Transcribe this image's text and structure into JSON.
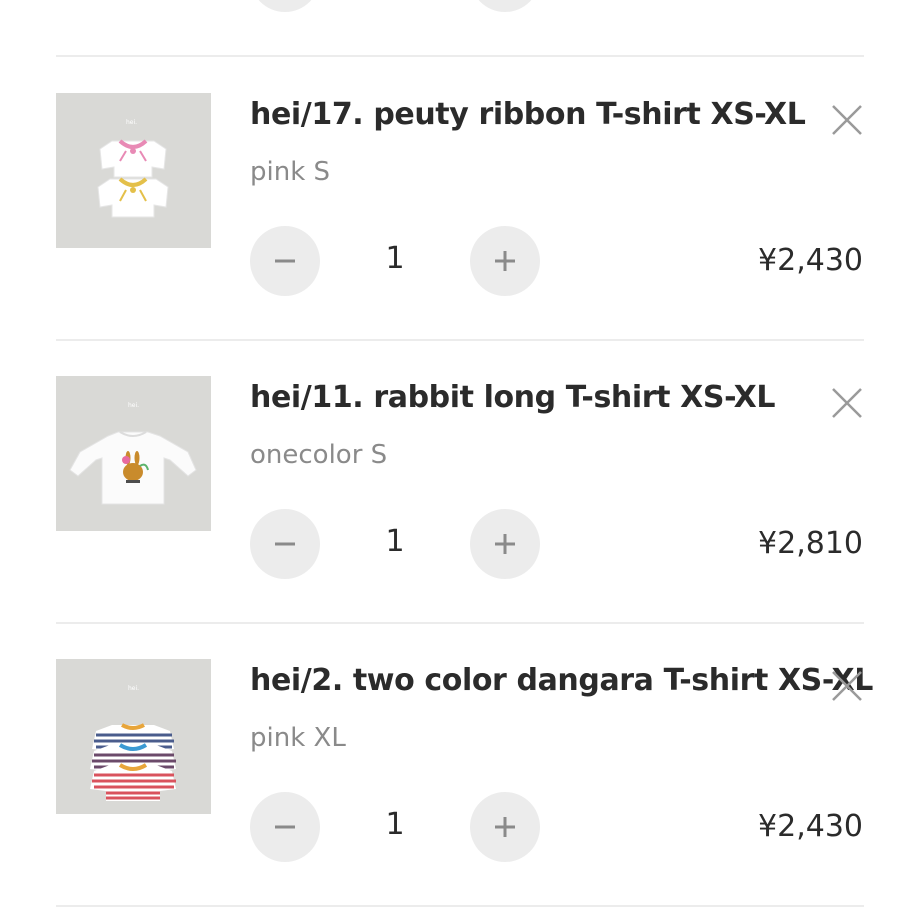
{
  "cart": {
    "items": [
      {
        "title": "hei/17. peuty ribbon T-shirt XS-XL",
        "variant": "pink S",
        "quantity": "1",
        "price": "¥2,430",
        "image_brand": "hei."
      },
      {
        "title": "hei/11. rabbit long T-shirt XS-XL",
        "variant": "onecolor S",
        "quantity": "1",
        "price": "¥2,810",
        "image_brand": "hei."
      },
      {
        "title": "hei/2. two color dangara T-shirt XS-XL",
        "variant": "pink XL",
        "quantity": "1",
        "price": "¥2,430",
        "image_brand": "hei."
      }
    ],
    "icons": {
      "remove": "close-icon",
      "decrease": "minus-icon",
      "increase": "plus-icon"
    },
    "colors": {
      "button_bg": "#ececec",
      "divider": "#ececec",
      "text": "#2b2b2b",
      "muted": "#8a8a8a"
    }
  }
}
